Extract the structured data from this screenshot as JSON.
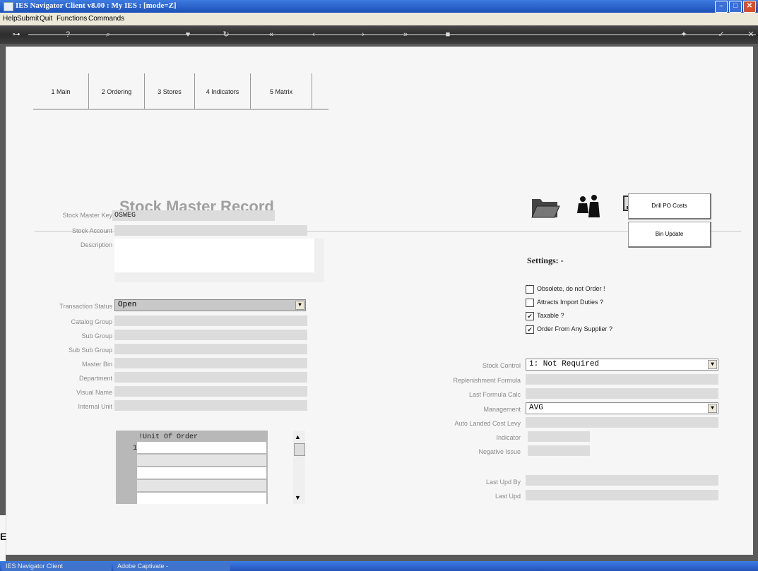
{
  "window": {
    "title": "IES Navigator Client v8.00 : My IES :      [mode=Z]"
  },
  "menu": [
    "Help",
    "Submit",
    "Quit",
    "Functions",
    "Commands"
  ],
  "tabs": [
    "1 Main",
    "2 Ordering",
    "3 Stores",
    "4 Indicators",
    "5 Matrix"
  ],
  "page_title": "Stock Master Record",
  "left_fields": {
    "stock_master_key": {
      "label": "Stock Master Key",
      "value": "OSWEG"
    },
    "stock_account": {
      "label": "Stock Account",
      "value": ""
    },
    "description": {
      "label": "Description",
      "value": ""
    },
    "transaction_status": {
      "label": "Transaction Status",
      "value": "Open"
    },
    "catalog_group": {
      "label": "Catalog Group",
      "value": ""
    },
    "sub_group": {
      "label": "Sub Group",
      "value": ""
    },
    "sub_sub_group": {
      "label": "Sub Sub Group",
      "value": ""
    },
    "master_bin": {
      "label": "Master Bin",
      "value": ""
    },
    "department": {
      "label": "Department",
      "value": ""
    },
    "visual_name": {
      "label": "Visual Name",
      "value": ""
    },
    "internal_unit": {
      "label": "Internal Unit",
      "value": ""
    }
  },
  "grid": {
    "header": "!Unit Of Order",
    "row_number": "1"
  },
  "buttons": {
    "drill_po_costs": "Drill PO Costs",
    "bin_update": "Bin Update"
  },
  "settings": {
    "heading": "Settings: -",
    "obsolete": {
      "label": "Obsolete, do not Order !",
      "checked": false
    },
    "attracts_import": {
      "label": "Attracts Import Duties ?",
      "checked": false
    },
    "taxable": {
      "label": "Taxable ?",
      "checked": true
    },
    "order_any_supplier": {
      "label": "Order From Any Supplier ?",
      "checked": true
    }
  },
  "right_fields": {
    "stock_control": {
      "label": "Stock Control",
      "value": "1: Not Required"
    },
    "replenishment_formula": {
      "label": "Replenishment Formula",
      "value": ""
    },
    "last_formula_calc": {
      "label": "Last Formula Calc",
      "value": ""
    },
    "management": {
      "label": "Management",
      "value": "AVG"
    },
    "auto_landed_cost_levy": {
      "label": "Auto Landed Cost Levy",
      "value": ""
    },
    "indicator": {
      "label": "Indicator",
      "value": ""
    },
    "negative_issue": {
      "label": "Negative Issue",
      "value": ""
    },
    "last_upd_by": {
      "label": "Last Upd By",
      "value": ""
    },
    "last_upd": {
      "label": "Last Upd",
      "value": ""
    }
  },
  "taskbar": {
    "item1": "IES Navigator Client",
    "item2": "Adobe Captivate - "
  },
  "icons": [
    "folder-icon",
    "people-icon",
    "transfer-icon",
    "book-icon"
  ]
}
